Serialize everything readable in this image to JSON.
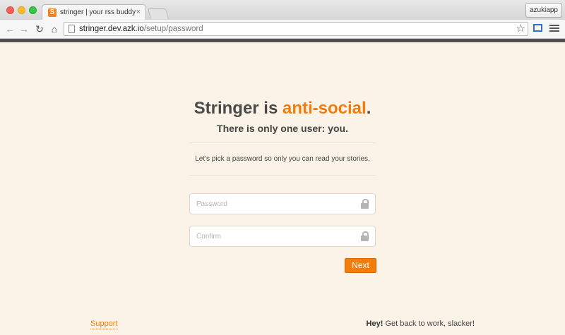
{
  "browser": {
    "tab_favicon": "S",
    "tab_title": "stringer | your rss buddy",
    "tab_close": "×",
    "profile_label": "azukiapp",
    "url_host": "stringer.dev.azk.io",
    "url_path": "/setup/password",
    "icons": {
      "back": "back-arrow-icon",
      "forward": "forward-arrow-icon",
      "reload": "reload-icon",
      "home": "home-icon",
      "page": "page-icon",
      "star": "star-icon",
      "cast": "cast-icon",
      "menu": "hamburger-menu-icon"
    }
  },
  "page": {
    "headline_prefix": "Stringer is ",
    "headline_accent": "anti-social",
    "headline_suffix": ".",
    "subhead": "There is only one user: you.",
    "intro": "Let's pick a password so only you can read your stories.",
    "password_placeholder": "Password",
    "confirm_placeholder": "Confirm",
    "next_label": "Next",
    "lock_icon": "lock-icon"
  },
  "footer": {
    "support_label": "Support",
    "hey": "Hey!",
    "message": " Get back to work, slacker!"
  },
  "colors": {
    "accent": "#f27d0c",
    "background": "#fbf3e7",
    "text": "#4a4a4a"
  }
}
